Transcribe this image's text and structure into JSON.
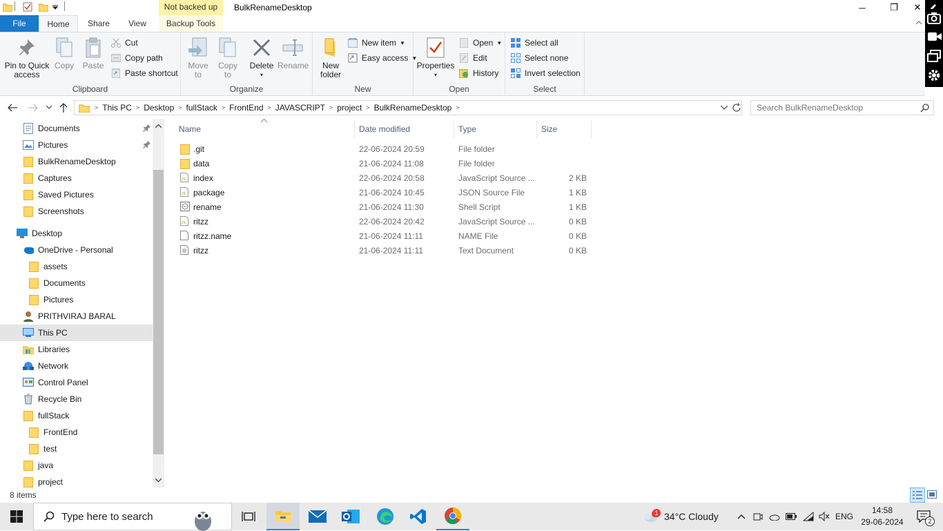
{
  "window": {
    "title": "BulkRenameDesktop",
    "contextual_tab": "Not backed up",
    "controls": {
      "minimize": "─",
      "maximize": "❐",
      "close": "✕"
    }
  },
  "tabs": {
    "file": "File",
    "home": "Home",
    "share": "Share",
    "view": "View",
    "backup_tools": "Backup Tools"
  },
  "ribbon": {
    "clipboard": {
      "label": "Clipboard",
      "pin_line1": "Pin to Quick",
      "pin_line2": "access",
      "copy": "Copy",
      "paste": "Paste",
      "cut": "Cut",
      "copy_path": "Copy path",
      "paste_shortcut": "Paste shortcut"
    },
    "organize": {
      "label": "Organize",
      "move_to_1": "Move",
      "move_to_2": "to",
      "copy_to_1": "Copy",
      "copy_to_2": "to",
      "delete": "Delete",
      "rename": "Rename"
    },
    "new": {
      "label": "New",
      "new_folder_1": "New",
      "new_folder_2": "folder",
      "new_item": "New item",
      "easy_access": "Easy access"
    },
    "open": {
      "label": "Open",
      "properties": "Properties",
      "open": "Open",
      "edit": "Edit",
      "history": "History"
    },
    "select": {
      "label": "Select",
      "select_all": "Select all",
      "select_none": "Select none",
      "invert_selection": "Invert selection"
    }
  },
  "address": {
    "crumbs": [
      "This PC",
      "Desktop",
      "fullStack",
      "FrontEnd",
      "JAVASCRIPT",
      "project",
      "BulkRenameDesktop"
    ],
    "search_placeholder": "Search BulkRenameDesktop"
  },
  "nav_pane": {
    "items": [
      {
        "label": "Documents",
        "icon": "documents-icon",
        "pinned": true
      },
      {
        "label": "Pictures",
        "icon": "pictures-icon",
        "pinned": true
      },
      {
        "label": "BulkRenameDesktop",
        "icon": "folder-icon"
      },
      {
        "label": "Captures",
        "icon": "folder-icon"
      },
      {
        "label": "Saved Pictures",
        "icon": "folder-icon"
      },
      {
        "label": "Screenshots",
        "icon": "folder-icon"
      },
      {
        "label": "Desktop",
        "icon": "desktop-icon"
      },
      {
        "label": "OneDrive - Personal",
        "icon": "onedrive-icon"
      },
      {
        "label": "assets",
        "icon": "folder-icon"
      },
      {
        "label": "Documents",
        "icon": "folder-icon"
      },
      {
        "label": "Pictures",
        "icon": "folder-icon"
      },
      {
        "label": "PRITHVIRAJ BARAL",
        "icon": "user-icon"
      },
      {
        "label": "This PC",
        "icon": "this-pc-icon",
        "selected": true
      },
      {
        "label": "Libraries",
        "icon": "libraries-icon"
      },
      {
        "label": "Network",
        "icon": "network-icon"
      },
      {
        "label": "Control Panel",
        "icon": "control-panel-icon"
      },
      {
        "label": "Recycle Bin",
        "icon": "recycle-bin-icon"
      },
      {
        "label": "fullStack",
        "icon": "folder-icon"
      },
      {
        "label": "FrontEnd",
        "icon": "folder-icon"
      },
      {
        "label": "test",
        "icon": "folder-icon"
      },
      {
        "label": "java",
        "icon": "folder-icon"
      },
      {
        "label": "project",
        "icon": "folder-icon"
      }
    ]
  },
  "file_list": {
    "columns": {
      "name": "Name",
      "date": "Date modified",
      "type": "Type",
      "size": "Size"
    },
    "rows": [
      {
        "name": ".git",
        "date": "22-06-2024 20:59",
        "type": "File folder",
        "size": "",
        "icon": "folder-icon"
      },
      {
        "name": "data",
        "date": "21-06-2024 11:08",
        "type": "File folder",
        "size": "",
        "icon": "folder-icon"
      },
      {
        "name": "index",
        "date": "22-06-2024 20:58",
        "type": "JavaScript Source ...",
        "size": "2 KB",
        "icon": "js-file-icon"
      },
      {
        "name": "package",
        "date": "21-06-2024 10:45",
        "type": "JSON Source File",
        "size": "1 KB",
        "icon": "js-file-icon"
      },
      {
        "name": "rename",
        "date": "21-06-2024 11:30",
        "type": "Shell Script",
        "size": "1 KB",
        "icon": "shell-file-icon"
      },
      {
        "name": "ritzz",
        "date": "22-06-2024 20:42",
        "type": "JavaScript Source ...",
        "size": "0 KB",
        "icon": "js-file-icon"
      },
      {
        "name": "ritzz.name",
        "date": "21-06-2024 11:11",
        "type": "NAME File",
        "size": "0 KB",
        "icon": "blank-file-icon"
      },
      {
        "name": "ritzz",
        "date": "21-06-2024 11:11",
        "type": "Text Document",
        "size": "0 KB",
        "icon": "text-file-icon"
      }
    ]
  },
  "status": {
    "count": "8 items"
  },
  "taskbar": {
    "search_placeholder": "Type here to search",
    "weather": "34°C  Cloudy",
    "weather_badge": "1",
    "language": "ENG",
    "time": "14:58",
    "date": "29-06-2024",
    "notification_count": "2"
  },
  "colors": {
    "accent": "#1979ca",
    "folder": "#ffd866",
    "selected": "#cce8ff",
    "backup_tab": "#fdf2a8"
  }
}
